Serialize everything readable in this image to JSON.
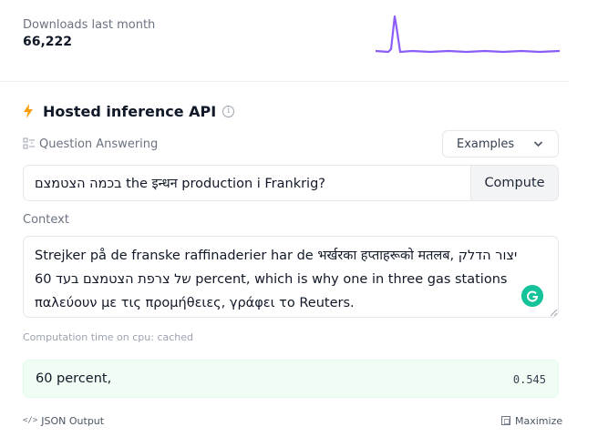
{
  "downloads": {
    "label": "Downloads last month",
    "count": "66,222",
    "sparkline_color": "#8b5cf6"
  },
  "inference": {
    "title": "Hosted inference API",
    "title_icon": "lightning-icon",
    "info_icon": "info-icon",
    "task_icon": "question-answering-icon",
    "task_label": "Question Answering",
    "examples_label": "Examples",
    "question_value": "בכמה הצטמצם the इन्धन production i Frankrig?",
    "compute_label": "Compute",
    "context_label": "Context",
    "context_value": "Strejker på de franske raffinaderier har de भर्खरका हप्ताहरूको मतलब, יצור הדלק של צרפת הצטמצם בעד 60 percent, which is why one in three gas stations παλεύουν με τις προμήθειες, γράφει το Reuters.",
    "computation_time": "Computation time on cpu: cached",
    "answer": "60 percent,",
    "score": "0.545",
    "json_output_label": "JSON Output",
    "maximize_label": "Maximize",
    "accent_color": "#f59e0b",
    "answer_bg_color": "#f0fdf4"
  }
}
